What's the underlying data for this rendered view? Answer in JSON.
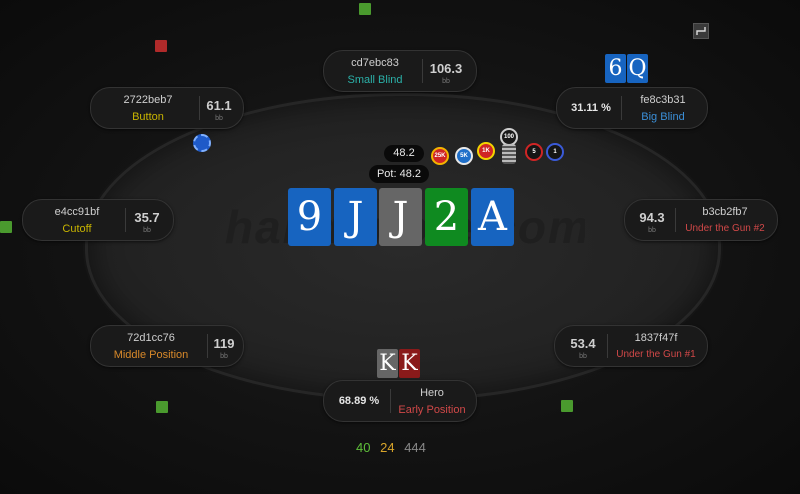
{
  "watermark": "hand2note.com",
  "pot": {
    "bet": "48.2",
    "label": "Pot: 48.2"
  },
  "chips": [
    "25K",
    "5K",
    "1K",
    "100",
    "5",
    "1"
  ],
  "board": [
    {
      "rank": "9",
      "color": "#1764c0"
    },
    {
      "rank": "J",
      "color": "#1764c0"
    },
    {
      "rank": "J",
      "color": "#666666"
    },
    {
      "rank": "2",
      "color": "#0f8a20"
    },
    {
      "rank": "A",
      "color": "#1764c0"
    }
  ],
  "hero_cards": [
    {
      "rank": "K",
      "color": "#666666"
    },
    {
      "rank": "K",
      "color": "#8a1a1a"
    }
  ],
  "bb_cards": [
    {
      "rank": "6",
      "color": "#1764c0"
    },
    {
      "rank": "Q",
      "color": "#1764c0"
    }
  ],
  "seats": {
    "small_blind": {
      "name": "cd7ebc83",
      "position": "Small Blind",
      "stack": "106.3",
      "unit": "bb"
    },
    "button": {
      "name": "2722beb7",
      "position": "Button",
      "stack": "61.1",
      "unit": "bb"
    },
    "big_blind": {
      "name": "fe8c3b31",
      "position": "Big Blind",
      "equity": "31.11 %"
    },
    "cutoff": {
      "name": "e4cc91bf",
      "position": "Cutoff",
      "stack": "35.7",
      "unit": "bb"
    },
    "utg2": {
      "name": "b3cb2fb7",
      "position": "Under the Gun #2",
      "stack": "94.3",
      "unit": "bb"
    },
    "middle": {
      "name": "72d1cc76",
      "position": "Middle Position",
      "stack": "119",
      "unit": "bb"
    },
    "utg1": {
      "name": "1837f47f",
      "position": "Under the Gun #1",
      "stack": "53.4",
      "unit": "bb"
    },
    "hero": {
      "name": "Hero",
      "position": "Early Position",
      "equity": "68.89 %"
    }
  },
  "footer": {
    "green": "40",
    "orange": "24",
    "gray": "444"
  },
  "colors": {
    "position_yellow": "#c8b400",
    "position_blue": "#3b8fd8",
    "position_red": "#d04848",
    "position_orange": "#d8892a",
    "position_teal": "#2bb0a8"
  }
}
